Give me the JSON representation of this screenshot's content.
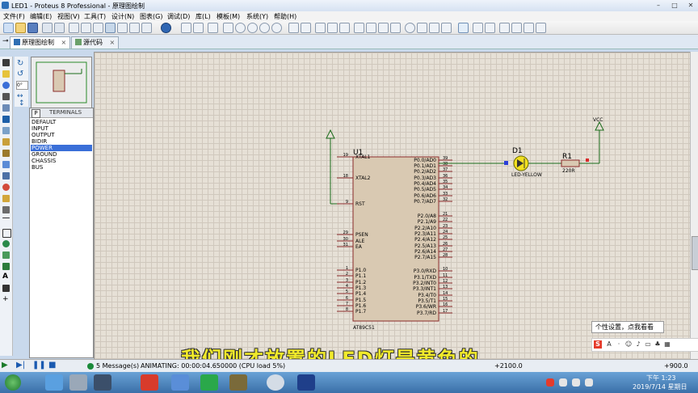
{
  "window": {
    "title": "LED1 - Proteus 8 Professional - 原理图绘制"
  },
  "menu": [
    "文件(F)",
    "编辑(E)",
    "视图(V)",
    "工具(T)",
    "设计(N)",
    "图表(G)",
    "调试(D)",
    "库(L)",
    "模板(M)",
    "系统(Y)",
    "帮助(H)"
  ],
  "tabs": [
    {
      "label": "原理图绘制",
      "close": "×"
    },
    {
      "label": "源代码",
      "close": "×"
    }
  ],
  "rotation": "0°",
  "terminals": {
    "mode": "P",
    "header": "TERMINALS",
    "items": [
      "DEFAULT",
      "INPUT",
      "OUTPUT",
      "BIDIR",
      "POWER",
      "GROUND",
      "CHASSIS",
      "BUS"
    ],
    "selected": "POWER"
  },
  "schematic": {
    "u1": {
      "ref": "U1",
      "part": "AT89C51",
      "left_pins": [
        {
          "num": "19",
          "name": "XTAL1"
        },
        {
          "num": "18",
          "name": "XTAL2"
        },
        {
          "num": "9",
          "name": "RST"
        },
        {
          "num": "29",
          "name": "PSEN"
        },
        {
          "num": "30",
          "name": "ALE"
        },
        {
          "num": "31",
          "name": "EA"
        },
        {
          "num": "1",
          "name": "P1.0"
        },
        {
          "num": "2",
          "name": "P1.1"
        },
        {
          "num": "3",
          "name": "P1.2"
        },
        {
          "num": "4",
          "name": "P1.3"
        },
        {
          "num": "5",
          "name": "P1.4"
        },
        {
          "num": "6",
          "name": "P1.5"
        },
        {
          "num": "7",
          "name": "P1.6"
        },
        {
          "num": "8",
          "name": "P1.7"
        }
      ],
      "right_pins": [
        {
          "num": "39",
          "name": "P0.0/AD0"
        },
        {
          "num": "38",
          "name": "P0.1/AD1"
        },
        {
          "num": "37",
          "name": "P0.2/AD2"
        },
        {
          "num": "36",
          "name": "P0.3/AD3"
        },
        {
          "num": "35",
          "name": "P0.4/AD4"
        },
        {
          "num": "34",
          "name": "P0.5/AD5"
        },
        {
          "num": "33",
          "name": "P0.6/AD6"
        },
        {
          "num": "32",
          "name": "P0.7/AD7"
        },
        {
          "num": "21",
          "name": "P2.0/A8"
        },
        {
          "num": "22",
          "name": "P2.1/A9"
        },
        {
          "num": "23",
          "name": "P2.2/A10"
        },
        {
          "num": "24",
          "name": "P2.3/A11"
        },
        {
          "num": "25",
          "name": "P2.4/A12"
        },
        {
          "num": "26",
          "name": "P2.5/A13"
        },
        {
          "num": "27",
          "name": "P2.6/A14"
        },
        {
          "num": "28",
          "name": "P2.7/A15"
        },
        {
          "num": "10",
          "name": "P3.0/RXD"
        },
        {
          "num": "11",
          "name": "P3.1/TXD"
        },
        {
          "num": "12",
          "name": "P3.2/INT0"
        },
        {
          "num": "13",
          "name": "P3.3/INT1"
        },
        {
          "num": "14",
          "name": "P3.4/T0"
        },
        {
          "num": "15",
          "name": "P3.5/T1"
        },
        {
          "num": "16",
          "name": "P3.6/WR"
        },
        {
          "num": "17",
          "name": "P3.7/RD"
        }
      ]
    },
    "d1": {
      "ref": "D1",
      "value": "LED-YELLOW"
    },
    "r1": {
      "ref": "R1",
      "value": "220R"
    },
    "vcc": "VCC"
  },
  "status": {
    "messages": "5 Message(s)",
    "animating": "ANIMATING: 00:00:04.650000 (CPU load 5%)",
    "coords": "+900.0",
    "coords2": "+2100.0"
  },
  "subtitle": "我们刚才放置的LED灯是黄色的",
  "tooltip": "个性设置，点我看看",
  "ime_label": "S",
  "clock": {
    "time": "下午 1:23",
    "date": "2019/7/14 星期日"
  },
  "colors": {
    "selection": "#3a6fd8",
    "canvas": "#e6e0d6",
    "ic_body": "#d9c9b2",
    "wire": "#1a6b1a",
    "led": "#f2e020"
  }
}
